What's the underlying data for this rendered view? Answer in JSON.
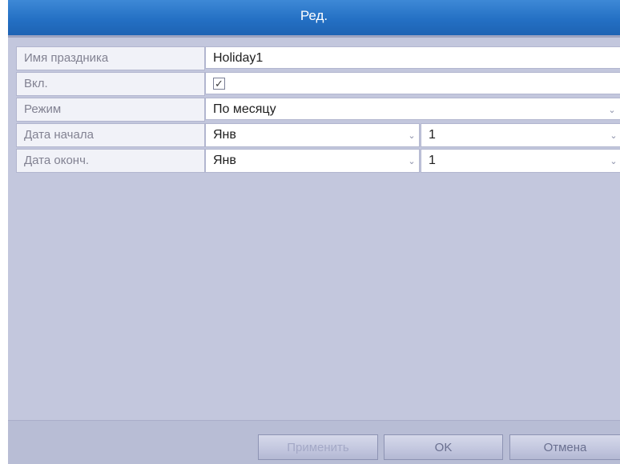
{
  "dialog": {
    "title": "Ред."
  },
  "fields": {
    "holiday_name": {
      "label": "Имя праздника",
      "value": "Holiday1"
    },
    "enabled": {
      "label": "Вкл.",
      "checked": true,
      "check_glyph": "✓"
    },
    "mode": {
      "label": "Режим",
      "value": "По месяцу"
    },
    "start_date": {
      "label": "Дата начала",
      "month": "Янв",
      "day": "1"
    },
    "end_date": {
      "label": "Дата оконч.",
      "month": "Янв",
      "day": "1"
    }
  },
  "icons": {
    "dropdown": "chevron-down-icon",
    "dropdown_glyph": "⌄"
  },
  "buttons": {
    "apply": "Применить",
    "ok": "OK",
    "cancel": "Отмена"
  },
  "colors": {
    "title_bar": "#2470c4",
    "panel_bg": "#c3c7dd",
    "label_bg": "#f1f2f8",
    "value_bg": "#ffffff"
  }
}
